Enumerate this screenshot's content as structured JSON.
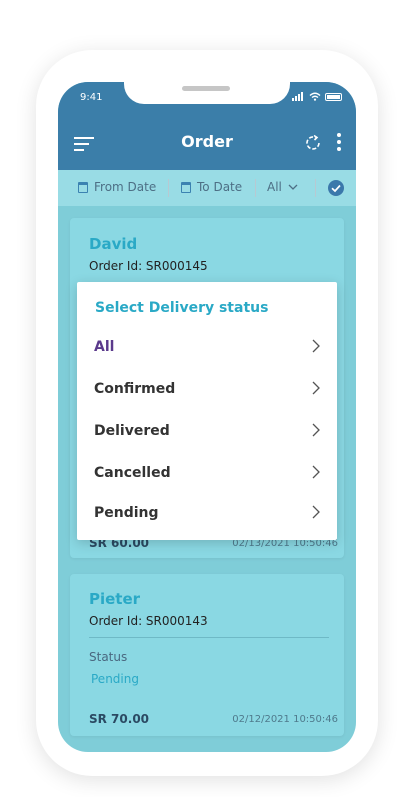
{
  "status_bar": {
    "time": "9:41"
  },
  "appbar": {
    "title": "Order"
  },
  "filters": {
    "from_date": "From Date",
    "to_date": "To Date",
    "status": "All"
  },
  "orders": [
    {
      "name": "David",
      "order_id": "Order Id: SR000145",
      "amount": "SR 60.00",
      "date": "02/13/2021  10:50:46"
    },
    {
      "name": "Pieter",
      "order_id": "Order Id: SR000143",
      "status_label": "Status",
      "status_value": "Pending",
      "amount": "SR 70.00",
      "date": "02/12/2021  10:50:46"
    }
  ],
  "modal": {
    "title": "Select Delivery status",
    "options": [
      "All",
      "Confirmed",
      "Delivered",
      "Cancelled",
      "Pending"
    ],
    "selected": "All"
  },
  "colors": {
    "appbar": "#3b7ea9",
    "accent": "#2aa9c6",
    "selected_option": "#5b3a8c",
    "screen_bg": "#7fcdd8"
  },
  "icons": [
    "menu-icon",
    "refresh-icon",
    "more-vertical-icon",
    "calendar-icon",
    "chevron-down-icon",
    "check-circle-icon",
    "chevron-right-icon"
  ]
}
